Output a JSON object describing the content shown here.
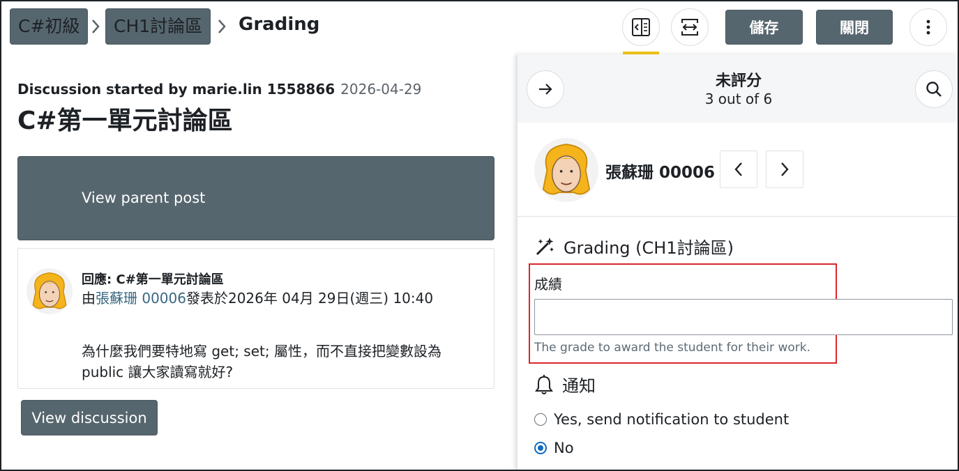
{
  "breadcrumb": {
    "items": [
      "C#初級",
      "CH1討論區"
    ],
    "current": "Grading"
  },
  "header": {
    "save_label": "儲存",
    "close_label": "關閉",
    "icons": [
      "collapse-grader-icon",
      "expand-view-icon",
      "more-options-icon"
    ]
  },
  "discussion": {
    "started_by": "Discussion started by marie.lin 1558866",
    "started_date": "2026-04-29",
    "title": "C#第一單元討論區",
    "view_parent_label": "View parent post",
    "reply": {
      "subject": "回應: C#第一單元討論區",
      "meta_prefix": "由",
      "author": "張蘇珊 00006",
      "meta_suffix": "發表於2026年 04月 29日(週三) 10:40",
      "body": "為什麼我們要特地寫 get; set; 屬性，而不直接把變數設為 public 讓大家讀寫就好?"
    },
    "view_discussion_label": "View discussion"
  },
  "grader": {
    "filter_title": "未評分",
    "filter_count": "3 out of 6",
    "student_name": "張蘇珊 00006",
    "grading_heading": "Grading (CH1討論區)",
    "grade_label": "成績",
    "grade_value": "",
    "grade_help": "The grade to award the student for their work.",
    "notify_heading": "通知",
    "notify_options": [
      {
        "label": "Yes, send notification to student",
        "checked": false
      },
      {
        "label": "No",
        "checked": true
      }
    ]
  },
  "colors": {
    "button_bg": "#56666e",
    "accent": "#f5c518",
    "highlight": "#d9262c",
    "radio": "#0f6cbf"
  }
}
